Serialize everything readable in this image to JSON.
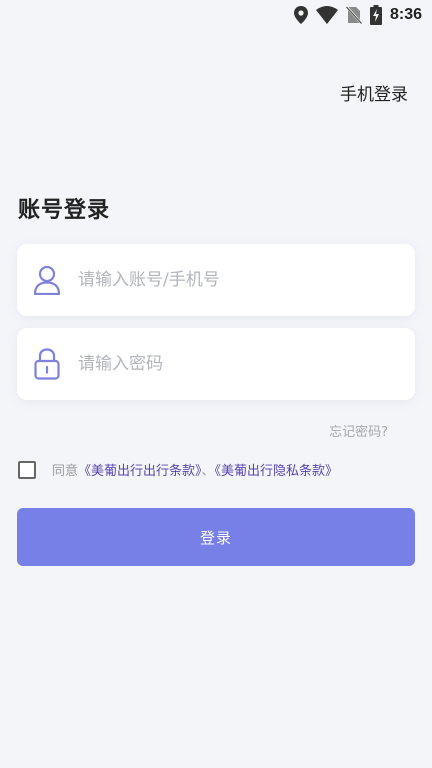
{
  "status_bar": {
    "time": "8:36",
    "icons": [
      "location-icon",
      "wifi-icon",
      "no-sim-icon",
      "battery-charging-icon"
    ]
  },
  "header": {
    "phone_login_label": "手机登录"
  },
  "page": {
    "title": "账号登录"
  },
  "form": {
    "account": {
      "icon": "user-icon",
      "value": "",
      "placeholder": "请输入账号/手机号"
    },
    "password": {
      "icon": "lock-icon",
      "value": "",
      "placeholder": "请输入密码"
    },
    "forgot_label": "忘记密码?"
  },
  "agreement": {
    "checked": false,
    "prefix": "同意",
    "terms_link": "《美葡出行出行条款》",
    "separator": "、",
    "privacy_link": "《美葡出行隐私条款》"
  },
  "login_button": {
    "label": "登录"
  },
  "colors": {
    "background": "#f4f5f9",
    "accent": "#7780e6",
    "link": "#5b46b0",
    "icon": "#7d82dc"
  }
}
